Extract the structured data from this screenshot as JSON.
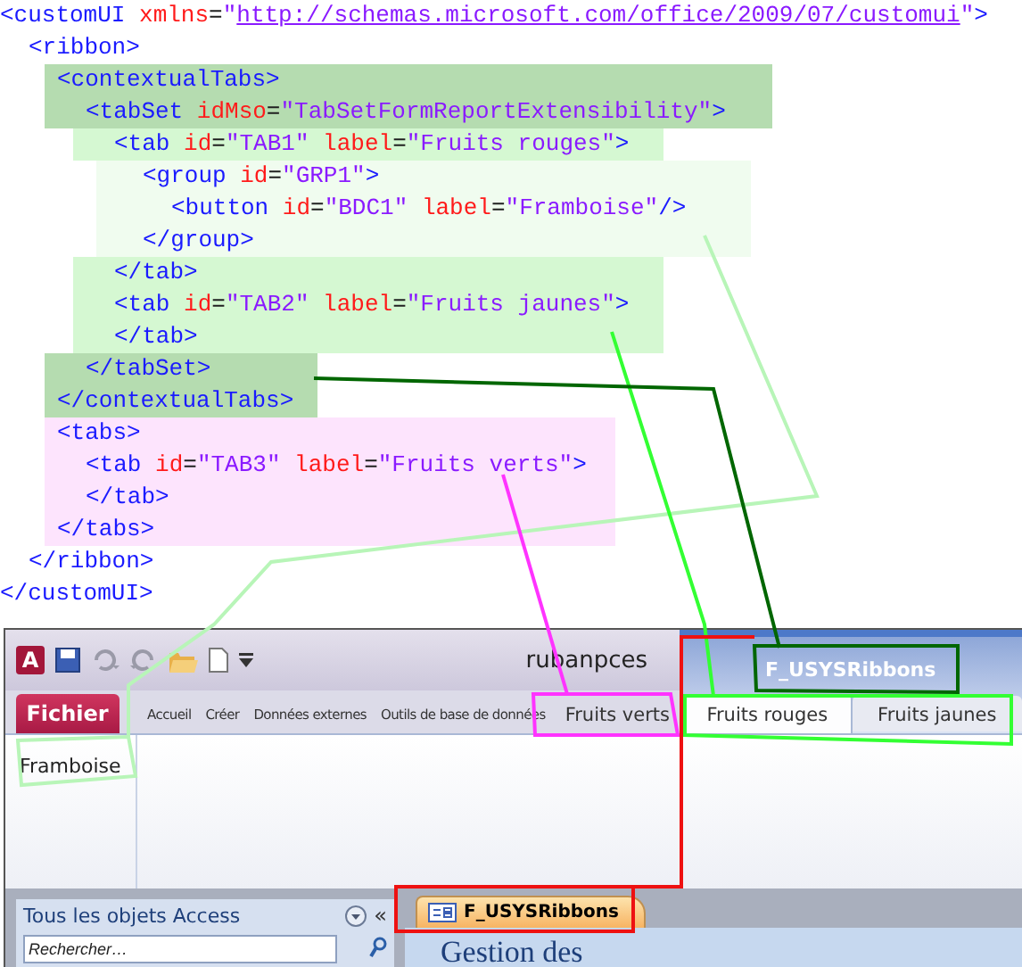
{
  "xml_code": [
    {
      "tokens": [
        {
          "kind": "tag",
          "text": "<customUI"
        },
        {
          "kind": "attr",
          "text": " xmlns"
        },
        {
          "kind": "eq",
          "text": "="
        },
        {
          "kind": "value",
          "text": "\""
        },
        {
          "kind": "link",
          "text": "http://schemas.microsoft.com/office/2009/07/customui"
        },
        {
          "kind": "value",
          "text": "\""
        },
        {
          "kind": "tag",
          "text": ">"
        }
      ],
      "children": [
        {
          "tokens": [
            {
              "kind": "tag",
              "text": "<ribbon>"
            }
          ],
          "children": [
            {
              "kind": "set-head",
              "tokens": [
                {
                  "kind": "tag",
                  "text": "<contextualTabs>"
                }
              ],
              "children": [
                {
                  "kind": "set-head",
                  "tokens": [
                    {
                      "kind": "tag",
                      "text": "<tabSet"
                    },
                    {
                      "kind": "attr",
                      "text": " idMso"
                    },
                    {
                      "kind": "eq",
                      "text": "="
                    },
                    {
                      "kind": "value",
                      "text": "\"TabSetFormReportExtensibility\""
                    },
                    {
                      "kind": "tag",
                      "text": ">"
                    }
                  ],
                  "children": [
                    {
                      "kind": "tab",
                      "tokens": [
                        {
                          "kind": "tag",
                          "text": "<tab"
                        },
                        {
                          "kind": "attr",
                          "text": " id"
                        },
                        {
                          "kind": "eq",
                          "text": "="
                        },
                        {
                          "kind": "value",
                          "text": "\"TAB1\""
                        },
                        {
                          "kind": "attr",
                          "text": " label"
                        },
                        {
                          "kind": "eq",
                          "text": "="
                        },
                        {
                          "kind": "value",
                          "text": "\"Fruits rouges\""
                        },
                        {
                          "kind": "tag",
                          "text": ">"
                        }
                      ],
                      "children": [
                        {
                          "kind": "group",
                          "tokens": [
                            {
                              "kind": "tag",
                              "text": "<group"
                            },
                            {
                              "kind": "attr",
                              "text": " id"
                            },
                            {
                              "kind": "eq",
                              "text": "="
                            },
                            {
                              "kind": "value",
                              "text": "\"GRP1\""
                            },
                            {
                              "kind": "tag",
                              "text": ">"
                            }
                          ],
                          "children": [
                            {
                              "kind": "group",
                              "tokens": [
                                {
                                  "kind": "tag",
                                  "text": "<button"
                                },
                                {
                                  "kind": "attr",
                                  "text": " id"
                                },
                                {
                                  "kind": "eq",
                                  "text": "="
                                },
                                {
                                  "kind": "value",
                                  "text": "\"BDC1\""
                                },
                                {
                                  "kind": "attr",
                                  "text": " label"
                                },
                                {
                                  "kind": "eq",
                                  "text": "="
                                },
                                {
                                  "kind": "value",
                                  "text": "\"Framboise\""
                                },
                                {
                                  "kind": "tag",
                                  "text": "/>"
                                }
                              ]
                            }
                          ]
                        },
                        {
                          "kind": "group",
                          "tokens": [
                            {
                              "kind": "tag",
                              "text": "</group>"
                            }
                          ]
                        }
                      ]
                    },
                    {
                      "kind": "tab",
                      "tokens": [
                        {
                          "kind": "tag",
                          "text": "</tab>"
                        }
                      ]
                    },
                    {
                      "kind": "tab",
                      "tokens": [
                        {
                          "kind": "tag",
                          "text": "<tab"
                        },
                        {
                          "kind": "attr",
                          "text": " id"
                        },
                        {
                          "kind": "eq",
                          "text": "="
                        },
                        {
                          "kind": "value",
                          "text": "\"TAB2\""
                        },
                        {
                          "kind": "attr",
                          "text": " label"
                        },
                        {
                          "kind": "eq",
                          "text": "="
                        },
                        {
                          "kind": "value",
                          "text": "\"Fruits jaunes\""
                        },
                        {
                          "kind": "tag",
                          "text": ">"
                        }
                      ]
                    },
                    {
                      "kind": "tab",
                      "tokens": [
                        {
                          "kind": "tag",
                          "text": "</tab>"
                        }
                      ]
                    }
                  ]
                },
                {
                  "kind": "set-foot",
                  "tokens": [
                    {
                      "kind": "tag",
                      "text": "</tabSet>"
                    }
                  ]
                }
              ]
            },
            {
              "kind": "set-foot",
              "tokens": [
                {
                  "kind": "tag",
                  "text": "</contextualTabs>"
                }
              ]
            },
            {
              "kind": "tabs",
              "tokens": [
                {
                  "kind": "tag",
                  "text": "<tabs>"
                }
              ],
              "children": [
                {
                  "kind": "tabs",
                  "tokens": [
                    {
                      "kind": "tag",
                      "text": "<tab"
                    },
                    {
                      "kind": "attr",
                      "text": " id"
                    },
                    {
                      "kind": "eq",
                      "text": "="
                    },
                    {
                      "kind": "value",
                      "text": "\"TAB3\""
                    },
                    {
                      "kind": "attr",
                      "text": " label"
                    },
                    {
                      "kind": "eq",
                      "text": "="
                    },
                    {
                      "kind": "value",
                      "text": "\"Fruits verts\""
                    },
                    {
                      "kind": "tag",
                      "text": ">"
                    }
                  ]
                },
                {
                  "kind": "tabs",
                  "tokens": [
                    {
                      "kind": "tag",
                      "text": "</tab>"
                    }
                  ]
                }
              ]
            },
            {
              "kind": "tabs",
              "tokens": [
                {
                  "kind": "tag",
                  "text": "</tabs>"
                }
              ]
            }
          ]
        },
        {
          "tokens": [
            {
              "kind": "tag",
              "text": "</ribbon>"
            }
          ]
        }
      ]
    },
    {
      "tokens": [
        {
          "kind": "tag",
          "text": "</customUI>"
        }
      ]
    }
  ],
  "window": {
    "app_icon": "A",
    "title": "rubanpces",
    "contextual_group": "F_USYSRibbons"
  },
  "ribbon_tabs": [
    {
      "label": "Fichier",
      "kind": "file",
      "selected": false
    },
    {
      "label": "Accueil",
      "kind": "builtin",
      "selected": false
    },
    {
      "label": "Créer",
      "kind": "builtin",
      "selected": false
    },
    {
      "label": "Données externes",
      "kind": "builtin",
      "selected": false
    },
    {
      "label": "Outils de base de données",
      "kind": "builtin",
      "selected": false
    },
    {
      "label": "Fruits verts",
      "kind": "custom",
      "selected": false
    },
    {
      "label": "Fruits rouges",
      "kind": "contextual",
      "selected": true
    },
    {
      "label": "Fruits jaunes",
      "kind": "contextual",
      "selected": false
    }
  ],
  "ribbon_group": {
    "buttons": [
      "Framboise"
    ]
  },
  "nav_pane": {
    "title": "Tous les objets Access",
    "collapse": "«",
    "search": {
      "placeholder": "Rechercher…"
    }
  },
  "document_tabs": [
    {
      "label": "F_USYSRibbons",
      "selected": true
    }
  ],
  "form": {
    "heading": "Gestion des"
  }
}
